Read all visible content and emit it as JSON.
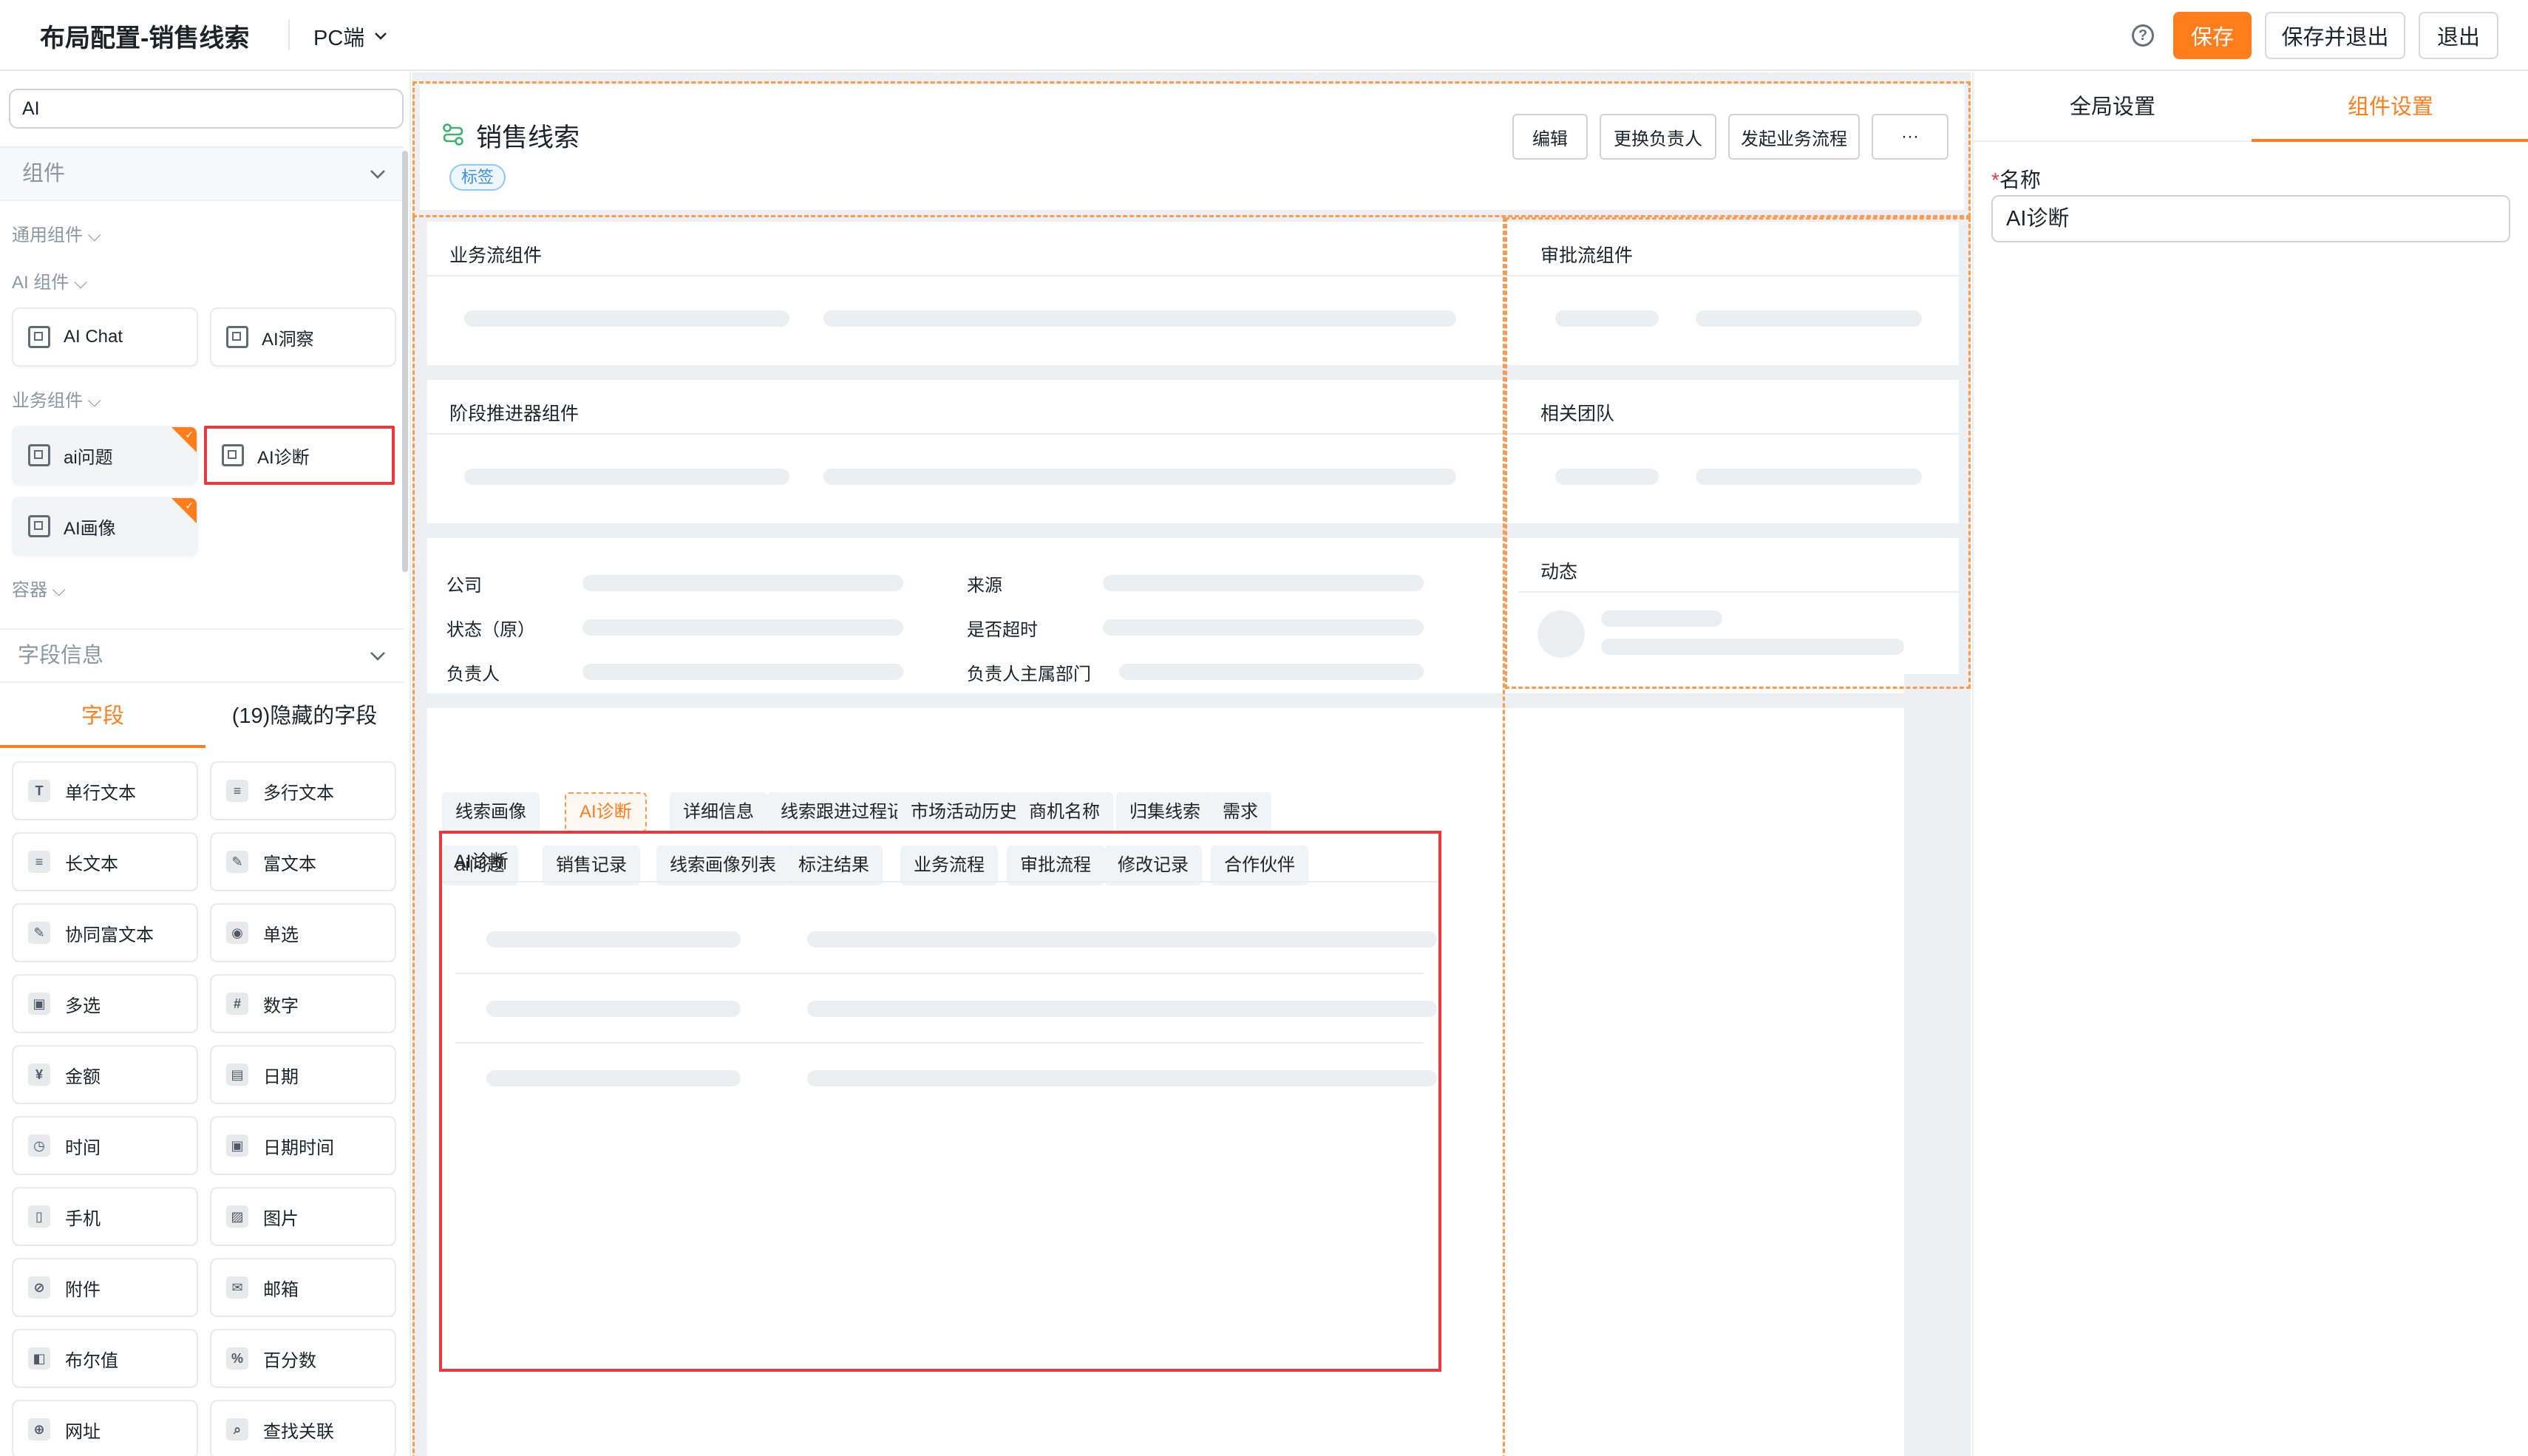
{
  "header": {
    "title": "布局配置-销售线索",
    "platform": "PC端",
    "save": "保存",
    "save_exit": "保存并退出",
    "exit": "退出"
  },
  "left": {
    "search_value": "AI",
    "components_header": "组件",
    "groups": {
      "general": "通用组件",
      "ai": "AI 组件",
      "business": "业务组件",
      "container": "容器"
    },
    "ai_components": [
      "AI Chat",
      "AI洞察"
    ],
    "business_components": [
      "ai问题",
      "AI诊断",
      "AI画像"
    ],
    "fields_header": "字段信息",
    "tab_fields": "字段",
    "tab_hidden": "(19)隐藏的字段",
    "fields": [
      {
        "label": "单行文本",
        "icon": "T"
      },
      {
        "label": "多行文本",
        "icon": "≡"
      },
      {
        "label": "长文本",
        "icon": "≡"
      },
      {
        "label": "富文本",
        "icon": "✎"
      },
      {
        "label": "协同富文本",
        "icon": "✎"
      },
      {
        "label": "单选",
        "icon": "◉"
      },
      {
        "label": "多选",
        "icon": "▣"
      },
      {
        "label": "数字",
        "icon": "#"
      },
      {
        "label": "金额",
        "icon": "¥"
      },
      {
        "label": "日期",
        "icon": "▤"
      },
      {
        "label": "时间",
        "icon": "◷"
      },
      {
        "label": "日期时间",
        "icon": "▣"
      },
      {
        "label": "手机",
        "icon": "▯"
      },
      {
        "label": "图片",
        "icon": "▨"
      },
      {
        "label": "附件",
        "icon": "⊘"
      },
      {
        "label": "邮箱",
        "icon": "✉"
      },
      {
        "label": "布尔值",
        "icon": "◧"
      },
      {
        "label": "百分数",
        "icon": "%"
      },
      {
        "label": "网址",
        "icon": "⊕"
      },
      {
        "label": "查找关联",
        "icon": "⌕"
      }
    ]
  },
  "canvas": {
    "record_title": "销售线索",
    "tag": "标签",
    "actions": [
      "编辑",
      "更换负责人",
      "发起业务流程",
      "···"
    ],
    "business_flow": "业务流组件",
    "stage_pusher": "阶段推进器组件",
    "approval_flow": "审批流组件",
    "team": "相关团队",
    "activity": "动态",
    "info_labels": [
      "公司",
      "来源",
      "状态（原）",
      "是否超时",
      "负责人",
      "负责人主属部门"
    ],
    "tabs_row1": [
      "线索画像",
      "AI诊断",
      "详细信息",
      "线索跟进过程记录",
      "市场活动历史",
      "商机名称",
      "归集线索",
      "需求"
    ],
    "tabs_row2": [
      "ai问题",
      "销售记录",
      "线索画像列表",
      "标注结果",
      "业务流程",
      "审批流程",
      "修改记录",
      "合作伙伴"
    ],
    "ai_diag_title": "AI诊断"
  },
  "right": {
    "tab_global": "全局设置",
    "tab_component": "组件设置",
    "name_label": "名称",
    "name_required": "*",
    "name_value": "AI诊断"
  },
  "colors": {
    "accent": "#ff7d1a",
    "selected_border": "#e8393f",
    "record_icon": "#3db26f"
  }
}
